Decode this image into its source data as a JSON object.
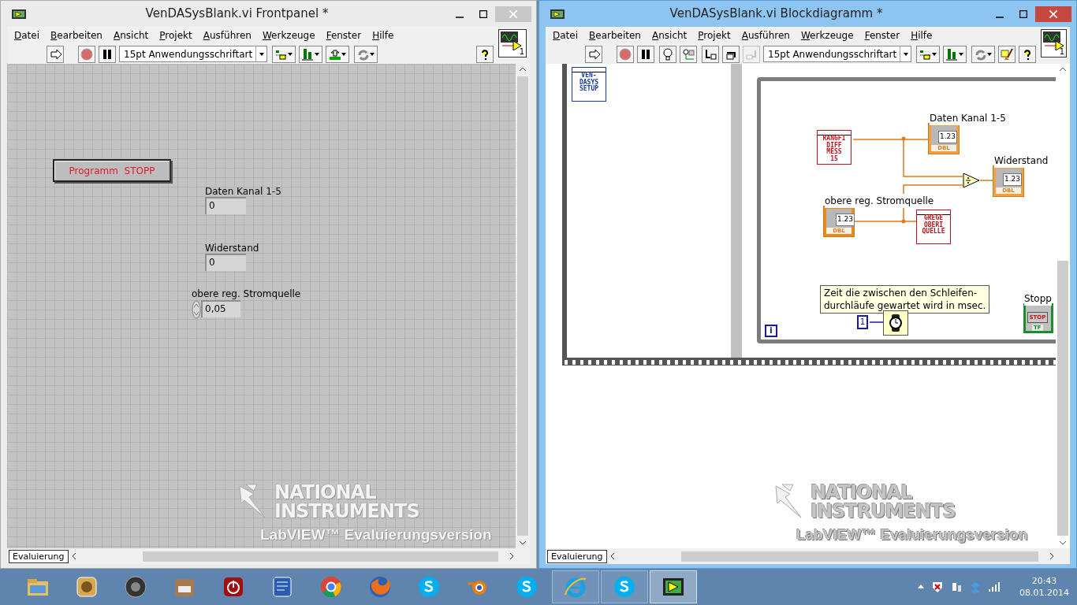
{
  "windows": [
    {
      "kind": "frontpanel",
      "title": "VenDASysBlank.vi Frontpanel *",
      "active": false,
      "menu": [
        "Datei",
        "Bearbeiten",
        "Ansicht",
        "Projekt",
        "Ausführen",
        "Werkzeuge",
        "Fenster",
        "Hilfe"
      ],
      "toolbar": [
        {
          "kind": "run",
          "disabled": false
        },
        {
          "kind": "abort",
          "disabled": false
        },
        {
          "kind": "pause",
          "disabled": false
        },
        {
          "kind": "font",
          "value": "15pt Anwendungsschriftart",
          "disabled": false
        },
        {
          "kind": "align",
          "disabled": false
        },
        {
          "kind": "distribute",
          "disabled": false
        },
        {
          "kind": "resize",
          "disabled": false
        },
        {
          "kind": "reorder",
          "disabled": false
        },
        {
          "kind": "help",
          "disabled": false
        }
      ],
      "vi_icon_number": "1",
      "controls": [
        {
          "kind": "button",
          "label": "Programm  STOPP"
        },
        {
          "kind": "indicator",
          "label": "Daten Kanal 1-5",
          "value": "0"
        },
        {
          "kind": "indicator",
          "label": "Widerstand",
          "value": "0"
        },
        {
          "kind": "numeric",
          "label": "obere reg. Stromquelle",
          "value": "0,05"
        }
      ],
      "watermark": {
        "brand": [
          "NATIONAL",
          "INSTRUMENTS"
        ],
        "product": "LabVIEW™ Evaluierungsversion"
      },
      "status": "Evaluierung"
    },
    {
      "kind": "diagram",
      "title": "VenDASysBlank.vi Blockdiagramm *",
      "active": true,
      "menu": [
        "Datei",
        "Bearbeiten",
        "Ansicht",
        "Projekt",
        "Ausführen",
        "Werkzeuge",
        "Fenster",
        "Hilfe"
      ],
      "toolbar": [
        {
          "kind": "run",
          "disabled": false
        },
        {
          "kind": "abort",
          "disabled": false
        },
        {
          "kind": "pause",
          "disabled": false
        },
        {
          "kind": "highlight",
          "disabled": false
        },
        {
          "kind": "retain",
          "disabled": false
        },
        {
          "kind": "step-into",
          "disabled": false
        },
        {
          "kind": "step-over",
          "disabled": false
        },
        {
          "kind": "step-out",
          "disabled": true
        },
        {
          "kind": "font",
          "value": "15pt Anwendungsschriftart",
          "disabled": false
        },
        {
          "kind": "align",
          "disabled": false
        },
        {
          "kind": "distribute",
          "disabled": false
        },
        {
          "kind": "reorder",
          "disabled": false
        },
        {
          "kind": "cleanup",
          "disabled": false
        },
        {
          "kind": "help",
          "disabled": false
        }
      ],
      "vi_icon_number": "1",
      "nodes": [
        {
          "kind": "subvi",
          "lines": [
            "VEN-",
            "DASYS",
            "SETUP"
          ],
          "color": "#1a3a9a"
        },
        {
          "kind": "subvi",
          "lines": [
            "RANGFI",
            "DIFF",
            "MESS",
            "15"
          ],
          "color": "#c0141c"
        },
        {
          "kind": "indicator",
          "label": "Daten Kanal 1-5",
          "value": "1.23",
          "type": "DBL"
        },
        {
          "kind": "divide"
        },
        {
          "kind": "indicator",
          "label": "Widerstand",
          "value": "1.23",
          "type": "DBL"
        },
        {
          "kind": "control",
          "label": "obere reg. Stromquelle",
          "value": "1.23",
          "type": "DBL"
        },
        {
          "kind": "subvi",
          "lines": [
            "GREGE",
            "OBERI",
            "QUELLE"
          ],
          "color": "#c0141c"
        },
        {
          "kind": "comment",
          "text": "Zeit die zwischen den Schleifen-\ndurchläufe gewartet wird in msec."
        },
        {
          "kind": "constant",
          "value": "1"
        },
        {
          "kind": "wait"
        },
        {
          "kind": "iteration",
          "value": "i"
        },
        {
          "kind": "stop",
          "label": "Stopp",
          "value": "STOP",
          "type": "TF"
        }
      ],
      "watermark": {
        "brand": [
          "NATIONAL",
          "INSTRUMENTS"
        ],
        "product": "LabVIEW™ Evaluierungsversion"
      },
      "status": "Evaluierung"
    }
  ],
  "taskbar": {
    "apps": [
      {
        "kind": "folder",
        "open": false,
        "selected": false
      },
      {
        "kind": "media",
        "open": false,
        "selected": false
      },
      {
        "kind": "speaker",
        "open": false,
        "selected": false
      },
      {
        "kind": "doc",
        "open": false,
        "selected": false
      },
      {
        "kind": "power",
        "open": false,
        "selected": false
      },
      {
        "kind": "settings",
        "open": false,
        "selected": false
      },
      {
        "kind": "chrome",
        "open": false,
        "selected": false
      },
      {
        "kind": "firefox",
        "open": false,
        "selected": false
      },
      {
        "kind": "skype",
        "open": false,
        "selected": false
      },
      {
        "kind": "blender",
        "open": false,
        "selected": false
      },
      {
        "kind": "skype",
        "open": false,
        "selected": false
      },
      {
        "kind": "ie",
        "open": true,
        "selected": false
      },
      {
        "kind": "skype",
        "open": true,
        "selected": false
      },
      {
        "kind": "labview",
        "open": true,
        "selected": true
      }
    ],
    "tray": [
      {
        "kind": "caret"
      },
      {
        "kind": "shield"
      },
      {
        "kind": "plug"
      },
      {
        "kind": "box"
      },
      {
        "kind": "signal"
      }
    ],
    "time": "20:43",
    "date": "08.01.2014"
  }
}
